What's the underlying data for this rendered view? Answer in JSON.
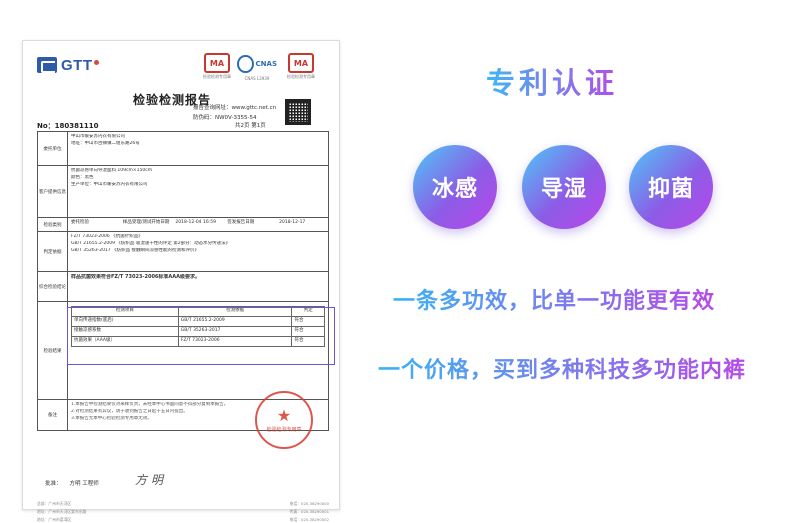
{
  "document": {
    "logo_text": "GTT",
    "cert_ma_1": "MA",
    "cert_cnas": "CNAS",
    "cert_ma_2": "MA",
    "cert_note_1": "检验检测专用章",
    "cert_note_2": "CNAS L3939",
    "cert_note_3": "检验检测专用章",
    "title": "检验检测报告",
    "query_site": "报告查询网址：www.gttc.net.cn",
    "anti_fake": "防伪码：NW0V-3355-54",
    "page": "共2页 第1页",
    "report_no": "No：180381110",
    "client_label": "委托单位",
    "client_lines": [
      "中山市暖安苏内衣有限公司",
      "地址：中山市古镇镇二组东路26号"
    ],
    "sample_label": "客户提供信息",
    "sample_lines": [
      "抗菌凉感单向导湿面料    109cm×150cm",
      "颜色：黑色",
      "生产单位：中山市暖安苏内衣有限公司"
    ],
    "test_label": "检验类别",
    "test_type": "委托检验",
    "test_date_label": "样品受理/测试开始日期",
    "test_date": "2018-12-04 16:59",
    "report_date_label": "签发报告日期",
    "report_date": "2018-12-17",
    "basis_label": "判定依据",
    "basis_lines": [
      "FZ/T 73023-2006 《抗菌针织品》",
      "GB/T 21655.2-2009 《纺织品 吸湿速干性的评定 第2部分：动态水分传递法》",
      "GB/T 35263-2017 《纺织品 接触瞬间凉感性能的检测和评价》"
    ],
    "conclusion_label": "综合检验结论",
    "conclusion": "样品抗菌效果符合FZ/T 73023-2006标准AAA级要求。",
    "detail_label": "检验结果",
    "result_headers": [
      "检测项目",
      "检测依据",
      "判定"
    ],
    "results": [
      [
        "单向传递指数(底后)",
        "GB/T 21655.2-2009",
        "符合"
      ],
      [
        "接触凉感系数",
        "GB/T 35263-2017",
        "符合"
      ],
      [
        "抗菌效果（AAA级）",
        "FZ/T 73023-2006",
        "符合"
      ]
    ],
    "remark_label": "备注",
    "remark_lines": [
      "1.本报告中检测结果仅对来样负责，未经本中心书面同意不得部分复制本报告。",
      "2.对检测结果有异议，请于收到报告之日起十五日内提出。",
      "3.本报告无本中心检验检测专用章无效。"
    ],
    "stamp_text": "检验检测专用章",
    "approver_label": "批准：",
    "approver_role": "方明  工程师",
    "signature": "方明",
    "footer_lines": [
      [
        "总部：广州市天河区",
        "电话：020-38290000"
      ],
      [
        "地址：广州市天河区棠东东路",
        "传真：020-38290001"
      ],
      [
        "地址：广州市荔湾区",
        "电话：020-38290002"
      ]
    ]
  },
  "marketing": {
    "headline": "专利认证",
    "badges": [
      "冰感",
      "导湿",
      "抑菌"
    ],
    "line1": "一条多功效，比单一功能更有效",
    "line2": "一个价格，买到多种科技多功能内裤",
    "colors": {
      "gradient_start": "#3fb7f5",
      "gradient_end": "#b34ce8",
      "highlight_box": "#6e55d8",
      "stamp": "#d9392e"
    }
  }
}
